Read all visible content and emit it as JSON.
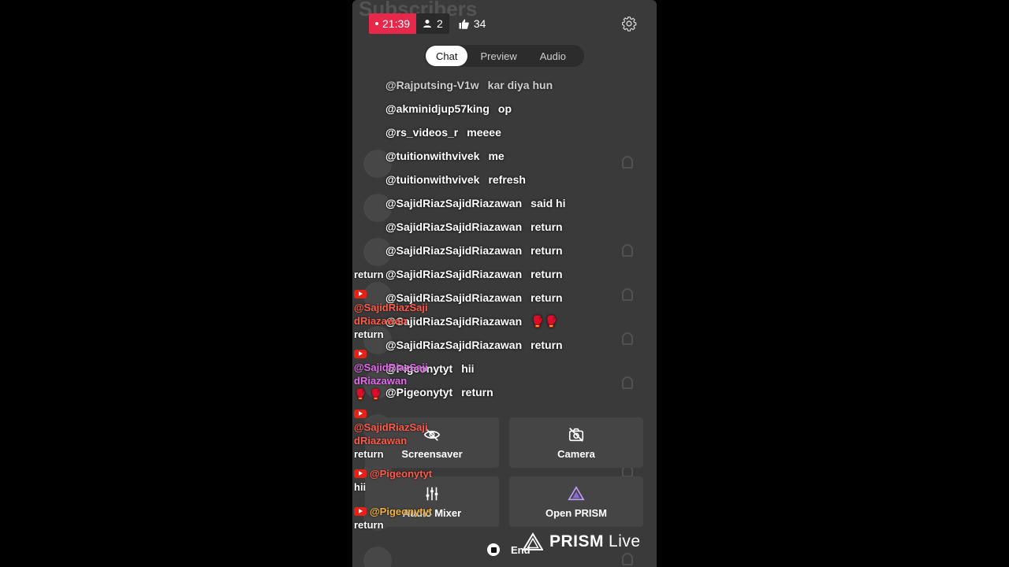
{
  "status": {
    "live_time": "21:39",
    "viewers": "2",
    "likes": "34"
  },
  "tabs": [
    {
      "label": "Chat",
      "active": true
    },
    {
      "label": "Preview",
      "active": false
    },
    {
      "label": "Audio",
      "active": false
    }
  ],
  "chat": [
    {
      "user": "@Rajputsing-V1w",
      "msg": "kar diya hun"
    },
    {
      "user": "@akminidjup57king",
      "msg": "op"
    },
    {
      "user": "@rs_videos_r",
      "msg": "meeee"
    },
    {
      "user": "@tuitionwithvivek",
      "msg": "me"
    },
    {
      "user": "@tuitionwithvivek",
      "msg": "refresh"
    },
    {
      "user": "@SajidRiazSajidRiazawan",
      "msg": "said hi"
    },
    {
      "user": "@SajidRiazSajidRiazawan",
      "msg": "return"
    },
    {
      "user": "@SajidRiazSajidRiazawan",
      "msg": "return"
    },
    {
      "user": "@SajidRiazSajidRiazawan",
      "msg": "return"
    },
    {
      "user": "@SajidRiazSajidRiazawan",
      "msg": "return"
    },
    {
      "user": "@SajidRiazSajidRiazawan",
      "msg": "🥊🥊"
    },
    {
      "user": "@SajidRiazSajidRiazawan",
      "msg": "return"
    },
    {
      "user": "@Pigeonytyt",
      "msg": "hii"
    },
    {
      "user": "@Pigeonytyt",
      "msg": "return"
    }
  ],
  "controls": {
    "screensaver": "Screensaver",
    "camera": "Camera",
    "audio_mixer": "Audio Mixer",
    "open_prism": "Open PRISM",
    "end": "End"
  },
  "overlay": [
    {
      "name": "",
      "msg": "return",
      "color": ""
    },
    {
      "name": "@SajidRiazSaji dRiazawan",
      "msg": "return",
      "color": "red"
    },
    {
      "name": "@SajidRiazSaji dRiazawan",
      "msg": "🥊 🥊",
      "color": "pink"
    },
    {
      "name": "@SajidRiazSaji dRiazawan",
      "msg": "return",
      "color": "red"
    },
    {
      "name": "@Pigeonytyt",
      "msg": "hii",
      "color": "red"
    },
    {
      "name": "@Pigeonytyt",
      "msg": "return",
      "color": "gold"
    }
  ],
  "watermark": {
    "brand": "PRISM",
    "suffix": "Live"
  },
  "background_ghost": {
    "title": "Subscribers"
  },
  "colors": {
    "live_red": "#e8284a",
    "panel": "#3a3a3a"
  }
}
